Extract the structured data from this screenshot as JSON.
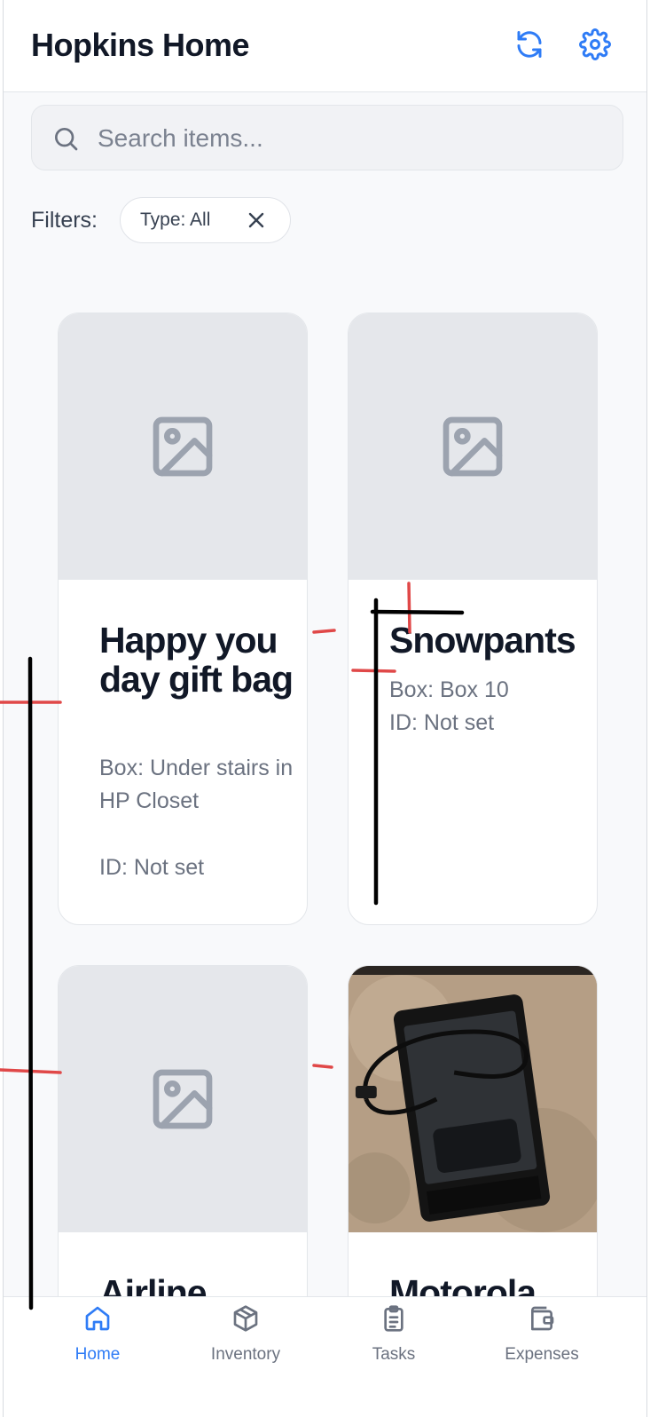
{
  "header": {
    "title": "Hopkins Home",
    "refresh_icon": "refresh-icon",
    "settings_icon": "gear-icon"
  },
  "search": {
    "placeholder": "Search items...",
    "value": ""
  },
  "filters": {
    "label": "Filters:",
    "chips": [
      {
        "label": "Type: All"
      }
    ]
  },
  "items": [
    {
      "name": "Happy you day gift bag",
      "box": "Box: Under stairs in HP Closet",
      "id": "ID: Not set",
      "image": "placeholder"
    },
    {
      "name": "Snowpants",
      "box": "Box: Box 10",
      "id": "ID: Not set",
      "image": "placeholder"
    },
    {
      "name": "Airline",
      "image": "placeholder"
    },
    {
      "name": "Motorola",
      "image": "photo"
    }
  ],
  "nav": {
    "items": [
      {
        "label": "Home",
        "icon": "home-icon",
        "active": true
      },
      {
        "label": "Inventory",
        "icon": "box-icon",
        "active": false
      },
      {
        "label": "Tasks",
        "icon": "clipboard-icon",
        "active": false
      },
      {
        "label": "Expenses",
        "icon": "wallet-icon",
        "active": false
      }
    ]
  },
  "colors": {
    "accent": "#2f7cf6",
    "text": "#111827",
    "muted": "#6b7280",
    "annotation_red": "#e04848",
    "annotation_black": "#000000"
  }
}
